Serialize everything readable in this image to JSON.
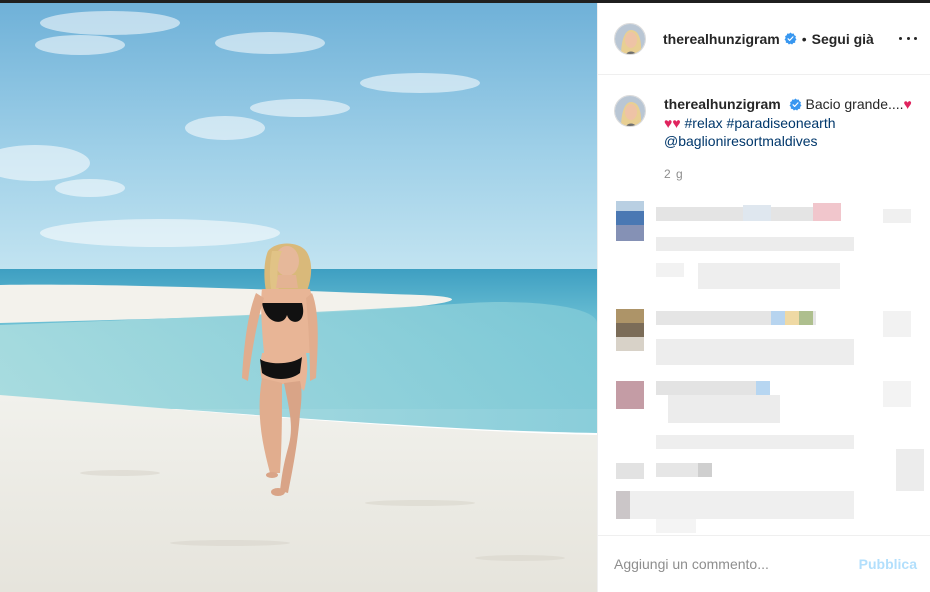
{
  "post": {
    "username": "therealhunzigram",
    "verified_icon": "verified-badge-icon",
    "separator": "•",
    "follow_label": "Segui già",
    "more_icon": "more-options-icon"
  },
  "caption": {
    "username": "therealhunzigram",
    "text_start": "Bacio grande....",
    "hearts_inline": "♥",
    "hearts_line2": "♥♥",
    "hashtag_relax": "#relax",
    "hashtag_paradise": "#paradiseonearth",
    "mention": "@baglioniresortmaldives",
    "timestamp": "2 g"
  },
  "add_comment": {
    "placeholder": "Aggiungi un commento...",
    "publish_label": "Pubblica"
  },
  "colors": {
    "link": "#00376b",
    "heart": "#e0245e",
    "publish_disabled": "#b2dffc",
    "verified": "#3897f0"
  }
}
